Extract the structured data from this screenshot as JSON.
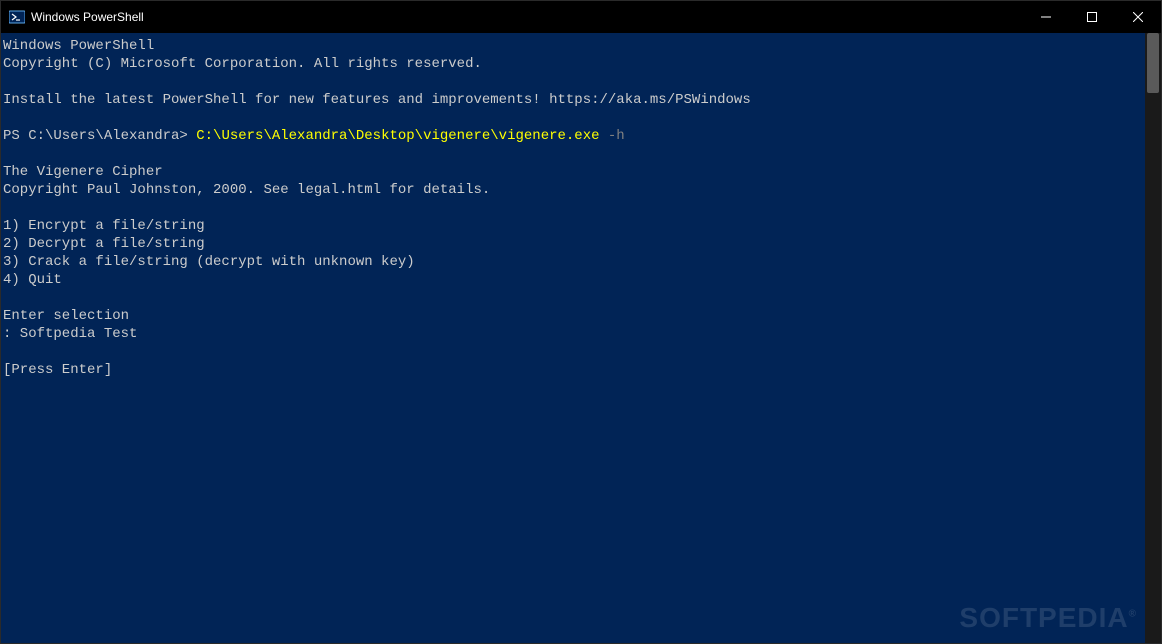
{
  "window": {
    "title": "Windows PowerShell"
  },
  "terminal": {
    "header1": "Windows PowerShell",
    "header2": "Copyright (C) Microsoft Corporation. All rights reserved.",
    "install_msg": "Install the latest PowerShell for new features and improvements! https://aka.ms/PSWindows",
    "prompt": "PS C:\\Users\\Alexandra> ",
    "command_path": "C:\\Users\\Alexandra\\Desktop\\vigenere\\vigenere.exe",
    "command_flag": " -h",
    "app_title": "The Vigenere Cipher",
    "app_copyright": "Copyright Paul Johnston, 2000. See legal.html for details.",
    "menu1": "1) Encrypt a file/string",
    "menu2": "2) Decrypt a file/string",
    "menu3": "3) Crack a file/string (decrypt with unknown key)",
    "menu4": "4) Quit",
    "enter_selection": "Enter selection",
    "selection_input": ": Softpedia Test",
    "press_enter": "[Press Enter]"
  },
  "watermark": "SOFTPEDIA"
}
